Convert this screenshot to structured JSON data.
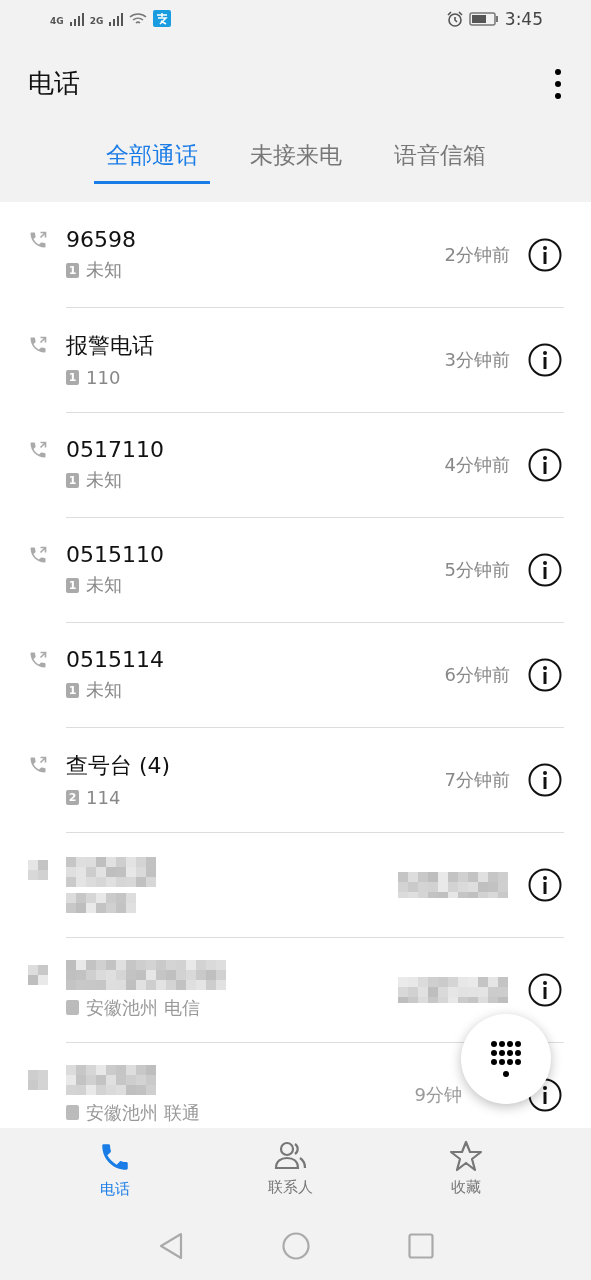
{
  "status_bar": {
    "network_1": "4G",
    "network_2": "2G",
    "time": "3:45"
  },
  "header": {
    "title": "电话"
  },
  "tabs": [
    {
      "label": "全部通话",
      "selected": true
    },
    {
      "label": "未接来电",
      "selected": false
    },
    {
      "label": "语音信箱",
      "selected": false
    }
  ],
  "calls": [
    {
      "kind": "call",
      "name": "96598",
      "sim": "1",
      "detail": "未知",
      "time": "2分钟前"
    },
    {
      "kind": "call",
      "name": "报警电话",
      "sim": "1",
      "detail": "110",
      "time": "3分钟前"
    },
    {
      "kind": "call",
      "name": "0517110",
      "sim": "1",
      "detail": "未知",
      "time": "4分钟前"
    },
    {
      "kind": "call",
      "name": "0515110",
      "sim": "1",
      "detail": "未知",
      "time": "5分钟前"
    },
    {
      "kind": "call",
      "name": "0515114",
      "sim": "1",
      "detail": "未知",
      "time": "6分钟前"
    },
    {
      "kind": "call",
      "name": "查号台 (4)",
      "sim": "2",
      "detail": "114",
      "time": "7分钟前"
    },
    {
      "kind": "redacted"
    },
    {
      "kind": "redacted",
      "detail": "安徽池州 电信"
    },
    {
      "kind": "redacted",
      "detail": "安徽池州 联通",
      "time": "9分钟"
    }
  ],
  "bottom_nav": [
    {
      "label": "电话",
      "selected": true
    },
    {
      "label": "联系人",
      "selected": false
    },
    {
      "label": "收藏",
      "selected": false
    }
  ]
}
